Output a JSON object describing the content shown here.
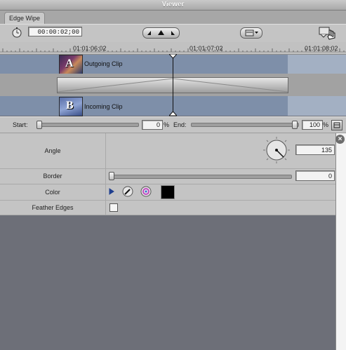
{
  "window": {
    "title": "Viewer"
  },
  "tab": {
    "label": "Edge Wipe"
  },
  "toolbar": {
    "timecode": "00:00:02;00",
    "icons": [
      "stopwatch-icon",
      "prev-edit-icon",
      "playhead-icon",
      "next-edit-icon",
      "view-popup-icon",
      "drag-hand-icon"
    ]
  },
  "ruler": {
    "labels": [
      "01:01:06;02",
      "01:01:07;02",
      "01:01:08;02"
    ]
  },
  "tracks": {
    "outgoing": {
      "label": "Outgoing Clip",
      "thumb_letter": "A"
    },
    "incoming": {
      "label": "Incoming Clip",
      "thumb_letter": "B"
    }
  },
  "start_end": {
    "start_label": "Start:",
    "start_value": "0",
    "start_unit": "%",
    "end_label": "End:",
    "end_value": "100",
    "end_unit": "%"
  },
  "params": {
    "angle": {
      "label": "Angle",
      "value": "135"
    },
    "border": {
      "label": "Border",
      "value": "0"
    },
    "color": {
      "label": "Color",
      "swatch": "#000000"
    },
    "feather": {
      "label": "Feather Edges",
      "checked": false
    }
  },
  "colors": {
    "track_blue": "#7e8fa9",
    "panel_gray": "#c4c4c4",
    "background": "#6d6f78"
  }
}
